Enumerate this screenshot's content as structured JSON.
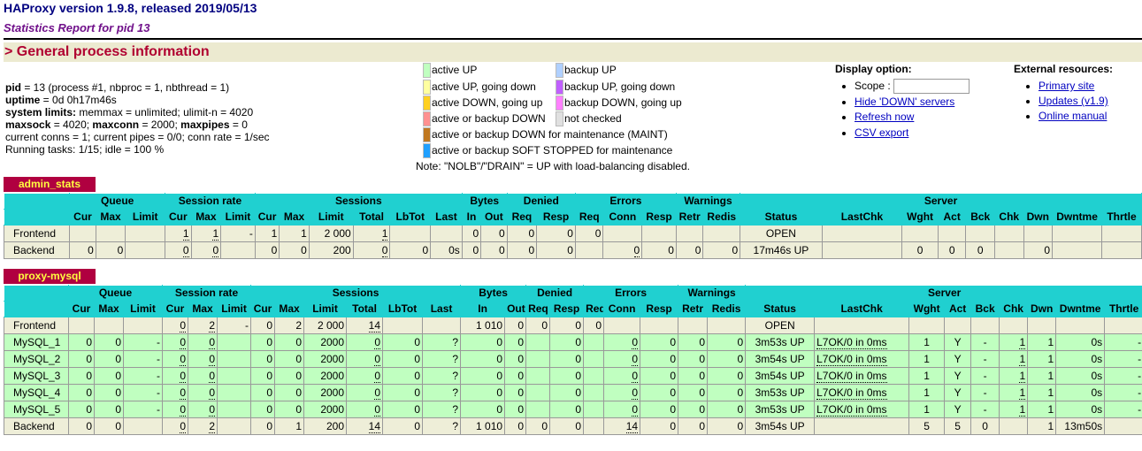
{
  "header": {
    "title": "HAProxy version 1.9.8, released 2019/05/13",
    "subtitle": "Statistics Report for pid 13",
    "section": "> General process information"
  },
  "process": {
    "pid_label": "pid",
    "pid_value": " = 13 (process #1, nbproc = 1, nbthread = 1)",
    "uptime_label": "uptime",
    "uptime_value": " = 0d 0h17m46s",
    "limits_label": "system limits:",
    "limits_value": " memmax = unlimited; ulimit-n = 4020",
    "maxsock_label": "maxsock",
    "maxsock_value": " = 4020; ",
    "maxconn_label": "maxconn",
    "maxconn_value": " = 2000; ",
    "maxpipes_label": "maxpipes",
    "maxpipes_value": " = 0",
    "conns_line": "current conns = 1; current pipes = 0/0; conn rate = 1/sec",
    "tasks_line": "Running tasks: 1/15; idle = 100 %"
  },
  "legend": {
    "active_up": {
      "label": "active UP",
      "color": "#c0ffc0"
    },
    "active_up_going_down": {
      "label": "active UP, going down",
      "color": "#ffffa0"
    },
    "active_down_going_up": {
      "label": "active DOWN, going up",
      "color": "#ffd020"
    },
    "active_backup_down": {
      "label": "active or backup DOWN",
      "color": "#ff9090"
    },
    "maint": {
      "label": "active or backup DOWN for maintenance (MAINT)",
      "color": "#c07820"
    },
    "soft_stopped": {
      "label": "active or backup SOFT STOPPED for maintenance",
      "color": "#20a0ff"
    },
    "backup_up": {
      "label": "backup UP",
      "color": "#b0d0ff"
    },
    "backup_up_going_down": {
      "label": "backup UP, going down",
      "color": "#c060ff"
    },
    "backup_down_going_up": {
      "label": "backup DOWN, going up",
      "color": "#ff80ff"
    },
    "not_checked": {
      "label": "not checked",
      "color": "#e0e0e0"
    },
    "note": "Note: \"NOLB\"/\"DRAIN\" = UP with load-balancing disabled."
  },
  "display_option": {
    "heading": "Display option:",
    "scope_label": "Scope :",
    "scope_value": "",
    "hide_down": "Hide 'DOWN' servers",
    "refresh": "Refresh now",
    "csv": "CSV export"
  },
  "external": {
    "heading": "External resources:",
    "primary_site": "Primary site",
    "updates": "Updates (v1.9)",
    "manual": "Online manual"
  },
  "table_headers": {
    "groups": [
      "Queue",
      "Session rate",
      "Sessions",
      "Bytes",
      "Denied",
      "Errors",
      "Warnings",
      "Server"
    ],
    "cols": [
      "Cur",
      "Max",
      "Limit",
      "Cur",
      "Max",
      "Limit",
      "Cur",
      "Max",
      "Limit",
      "Total",
      "LbTot",
      "Last",
      "In",
      "Out",
      "Req",
      "Resp",
      "Req",
      "Conn",
      "Resp",
      "Retr",
      "Redis",
      "Status",
      "LastChk",
      "Wght",
      "Act",
      "Bck",
      "Chk",
      "Dwn",
      "Dwntme",
      "Thrtle"
    ]
  },
  "admin_stats": {
    "name": "admin_stats",
    "rows": [
      {
        "kind": "frontend",
        "cells": [
          "Frontend",
          "",
          "",
          "",
          "1",
          "1",
          "-",
          "1",
          "1",
          "2 000",
          "1",
          "",
          "",
          "0",
          "0",
          "0",
          "0",
          "0",
          "",
          "",
          "",
          "",
          "OPEN",
          "",
          "",
          "",
          "",
          "",
          "",
          "",
          ""
        ]
      },
      {
        "kind": "backend",
        "cells": [
          "Backend",
          "0",
          "0",
          "",
          "0",
          "0",
          "",
          "0",
          "0",
          "200",
          "0",
          "0",
          "0s",
          "0",
          "0",
          "0",
          "0",
          "",
          "0",
          "0",
          "0",
          "0",
          "17m46s UP",
          "",
          "0",
          "0",
          "0",
          "",
          "0",
          "",
          ""
        ]
      }
    ]
  },
  "proxy_mysql": {
    "name": "proxy-mysql",
    "rows": [
      {
        "kind": "frontend",
        "cells": [
          "Frontend",
          "",
          "",
          "",
          "0",
          "2",
          "-",
          "0",
          "2",
          "2 000",
          "14",
          "",
          "",
          "1 010",
          "0",
          "0",
          "0",
          "0",
          "",
          "",
          "",
          "",
          "OPEN",
          "",
          "",
          "",
          "",
          "",
          "",
          "",
          ""
        ]
      },
      {
        "kind": "server",
        "cells": [
          "MySQL_1",
          "0",
          "0",
          "-",
          "0",
          "0",
          "",
          "0",
          "0",
          "2000",
          "0",
          "0",
          "?",
          "0",
          "0",
          "",
          "0",
          "",
          "0",
          "0",
          "0",
          "0",
          "3m53s UP",
          "L7OK/0 in 0ms",
          "1",
          "Y",
          "-",
          "1",
          "1",
          "0s",
          "-"
        ]
      },
      {
        "kind": "server",
        "cells": [
          "MySQL_2",
          "0",
          "0",
          "-",
          "0",
          "0",
          "",
          "0",
          "0",
          "2000",
          "0",
          "0",
          "?",
          "0",
          "0",
          "",
          "0",
          "",
          "0",
          "0",
          "0",
          "0",
          "3m54s UP",
          "L7OK/0 in 0ms",
          "1",
          "Y",
          "-",
          "1",
          "1",
          "0s",
          "-"
        ]
      },
      {
        "kind": "server",
        "cells": [
          "MySQL_3",
          "0",
          "0",
          "-",
          "0",
          "0",
          "",
          "0",
          "0",
          "2000",
          "0",
          "0",
          "?",
          "0",
          "0",
          "",
          "0",
          "",
          "0",
          "0",
          "0",
          "0",
          "3m54s UP",
          "L7OK/0 in 0ms",
          "1",
          "Y",
          "-",
          "1",
          "1",
          "0s",
          "-"
        ]
      },
      {
        "kind": "server",
        "cells": [
          "MySQL_4",
          "0",
          "0",
          "-",
          "0",
          "0",
          "",
          "0",
          "0",
          "2000",
          "0",
          "0",
          "?",
          "0",
          "0",
          "",
          "0",
          "",
          "0",
          "0",
          "0",
          "0",
          "3m53s UP",
          "L7OK/0 in 0ms",
          "1",
          "Y",
          "-",
          "1",
          "1",
          "0s",
          "-"
        ]
      },
      {
        "kind": "server",
        "cells": [
          "MySQL_5",
          "0",
          "0",
          "-",
          "0",
          "0",
          "",
          "0",
          "0",
          "2000",
          "0",
          "0",
          "?",
          "0",
          "0",
          "",
          "0",
          "",
          "0",
          "0",
          "0",
          "0",
          "3m53s UP",
          "L7OK/0 in 0ms",
          "1",
          "Y",
          "-",
          "1",
          "1",
          "0s",
          "-"
        ]
      },
      {
        "kind": "backend",
        "cells": [
          "Backend",
          "0",
          "0",
          "",
          "0",
          "2",
          "",
          "0",
          "1",
          "200",
          "14",
          "0",
          "?",
          "1 010",
          "0",
          "0",
          "0",
          "",
          "14",
          "0",
          "0",
          "0",
          "3m54s UP",
          "",
          "5",
          "5",
          "0",
          "",
          "1",
          "13m50s",
          ""
        ]
      }
    ]
  }
}
